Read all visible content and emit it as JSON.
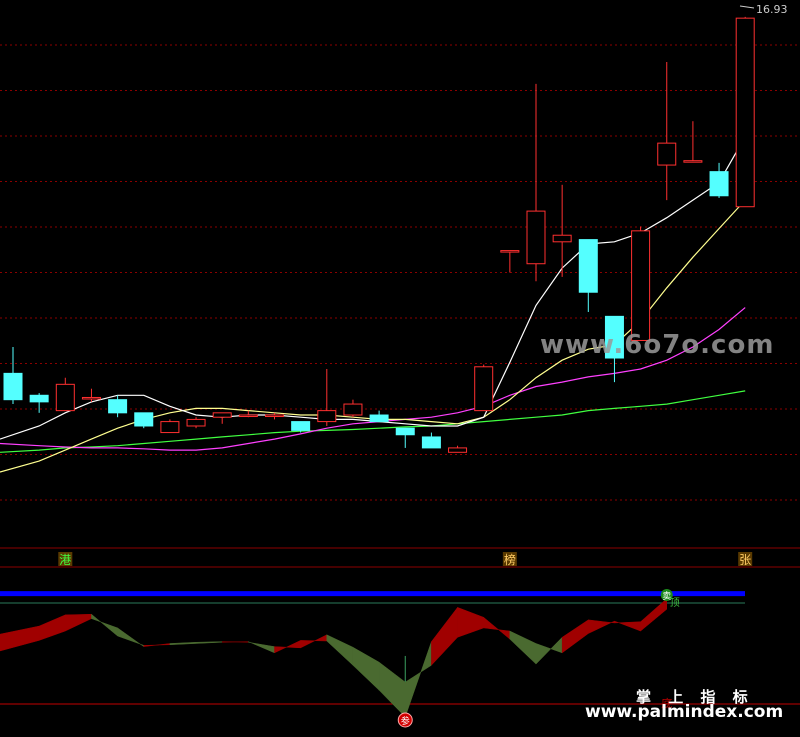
{
  "chart_data": {
    "type": "candlestick",
    "price_label": "16.93",
    "price_axis": {
      "ylim": [
        5.0,
        17.2
      ]
    },
    "candles": [
      {
        "o": 8.8,
        "h": 9.4,
        "l": 8.1,
        "c": 8.2
      },
      {
        "o": 8.3,
        "h": 8.35,
        "l": 7.9,
        "c": 8.15
      },
      {
        "o": 7.95,
        "h": 8.7,
        "l": 7.95,
        "c": 8.55
      },
      {
        "o": 8.25,
        "h": 8.45,
        "l": 8.15,
        "c": 8.25
      },
      {
        "o": 8.2,
        "h": 8.3,
        "l": 7.8,
        "c": 7.9
      },
      {
        "o": 7.9,
        "h": 7.9,
        "l": 7.55,
        "c": 7.6
      },
      {
        "o": 7.45,
        "h": 7.75,
        "l": 7.45,
        "c": 7.7
      },
      {
        "o": 7.6,
        "h": 7.8,
        "l": 7.55,
        "c": 7.75
      },
      {
        "o": 7.8,
        "h": 7.9,
        "l": 7.65,
        "c": 7.9
      },
      {
        "o": 7.85,
        "h": 7.95,
        "l": 7.8,
        "c": 7.85
      },
      {
        "o": 7.85,
        "h": 7.9,
        "l": 7.75,
        "c": 7.85
      },
      {
        "o": 7.7,
        "h": 7.7,
        "l": 7.45,
        "c": 7.5
      },
      {
        "o": 7.7,
        "h": 8.9,
        "l": 7.6,
        "c": 7.95
      },
      {
        "o": 7.85,
        "h": 8.2,
        "l": 7.8,
        "c": 8.1
      },
      {
        "o": 7.85,
        "h": 7.95,
        "l": 7.7,
        "c": 7.7
      },
      {
        "o": 7.55,
        "h": 7.55,
        "l": 7.1,
        "c": 7.4
      },
      {
        "o": 7.35,
        "h": 7.45,
        "l": 7.3,
        "c": 7.1
      },
      {
        "o": 7.0,
        "h": 7.15,
        "l": 7.0,
        "c": 7.1
      },
      {
        "o": 7.95,
        "h": 9.0,
        "l": 7.95,
        "c": 8.95
      },
      {
        "o": 11.6,
        "h": 11.6,
        "l": 11.1,
        "c": 11.6
      },
      {
        "o": 11.3,
        "h": 15.4,
        "l": 10.9,
        "c": 12.5
      },
      {
        "o": 11.8,
        "h": 13.1,
        "l": 11.0,
        "c": 11.95
      },
      {
        "o": 11.85,
        "h": 11.85,
        "l": 10.2,
        "c": 10.65
      },
      {
        "o": 10.1,
        "h": 10.1,
        "l": 8.6,
        "c": 9.15
      },
      {
        "o": 9.55,
        "h": 12.15,
        "l": 9.55,
        "c": 12.05
      },
      {
        "o": 13.55,
        "h": 15.9,
        "l": 12.75,
        "c": 14.05
      },
      {
        "o": 13.65,
        "h": 14.55,
        "l": 13.65,
        "c": 13.65
      },
      {
        "o": 13.4,
        "h": 13.6,
        "l": 12.8,
        "c": 12.85
      },
      {
        "o": 12.6,
        "h": 16.93,
        "l": 12.6,
        "c": 16.9
      }
    ],
    "ma_white": [
      7.3,
      7.6,
      7.9,
      8.15,
      8.3,
      8.3,
      8.05,
      7.85,
      7.8,
      7.85,
      7.85,
      7.8,
      7.75,
      7.75,
      7.7,
      7.65,
      7.6,
      7.6,
      7.8,
      9.05,
      10.35,
      11.2,
      11.75,
      11.8,
      12.0,
      12.35,
      12.75,
      13.15,
      14.2
    ],
    "ma_yellow": [
      6.55,
      6.8,
      7.05,
      7.3,
      7.55,
      7.75,
      7.9,
      8.0,
      8.0,
      7.95,
      7.9,
      7.85,
      7.85,
      7.8,
      7.75,
      7.75,
      7.7,
      7.65,
      7.8,
      8.2,
      8.7,
      9.1,
      9.35,
      9.45,
      10.0,
      10.75,
      11.45,
      12.1,
      12.75
    ],
    "ma_magenta": [
      7.2,
      7.15,
      7.12,
      7.1,
      7.1,
      7.08,
      7.05,
      7.05,
      7.1,
      7.2,
      7.3,
      7.42,
      7.55,
      7.65,
      7.7,
      7.75,
      7.8,
      7.9,
      8.05,
      8.3,
      8.5,
      8.6,
      8.72,
      8.8,
      8.9,
      9.1,
      9.4,
      9.8,
      10.3
    ],
    "ma_green": [
      7.0,
      7.05,
      7.1,
      7.12,
      7.15,
      7.2,
      7.25,
      7.3,
      7.35,
      7.4,
      7.45,
      7.48,
      7.5,
      7.52,
      7.55,
      7.58,
      7.6,
      7.65,
      7.7,
      7.75,
      7.8,
      7.85,
      7.95,
      8.0,
      8.05,
      8.1,
      8.2,
      8.3,
      8.4
    ],
    "signal_labels": [
      {
        "index": 2,
        "text": "港"
      },
      {
        "index": 19,
        "text": "榜"
      },
      {
        "index": 28,
        "text": "张"
      }
    ],
    "indicator": {
      "ylim": [
        -10,
        12
      ],
      "upper_line": 9.0,
      "upper_line_color": "#0000ff",
      "line_a": [
        2.5,
        3.8,
        5.6,
        5.7,
        2.2,
        0.7,
        0.8,
        1.0,
        1.2,
        1.3,
        -0.5,
        1.5,
        1.4,
        -2.5,
        -6.5,
        -10.8,
        1.3,
        6.8,
        5.2,
        1.7,
        -2.3,
        2.0,
        4.8,
        4.3,
        4.5,
        8.2
      ],
      "line_b": [
        -0.2,
        1.5,
        3.0,
        5.0,
        3.5,
        0.5,
        1.0,
        1.2,
        1.3,
        1.2,
        0.5,
        0.3,
        2.4,
        0.4,
        -2.0,
        -5.2,
        -2.5,
        2.0,
        3.5,
        3.0,
        1.0,
        -0.5,
        2.6,
        4.6,
        3.0,
        6.5
      ],
      "bars": [
        2.4,
        3.2,
        3.5,
        3.8,
        2.8,
        2.0,
        1.8,
        1.8,
        1.9,
        2.0,
        1.7,
        1.5,
        1.6,
        0.5,
        0.0,
        -1.0,
        0.2,
        2.0,
        3.6,
        4.0,
        4.2,
        4.5,
        4.8,
        4.8,
        4.8,
        6.8
      ],
      "labels": [
        {
          "text": "卖",
          "color": "#2a8a2a"
        },
        {
          "text": "顶",
          "color": "#2a8a2a"
        },
        {
          "text": "底",
          "color": "#c00000"
        },
        {
          "text": "参",
          "color": "#d00000"
        }
      ]
    }
  },
  "watermarks": [
    "www.6o7o.com",
    "掌 上 指 标",
    "www.palmindex.com"
  ],
  "colors": {
    "background": "#000000",
    "up": "#ff3030",
    "down": "#54ffff",
    "grid": "#8b0000",
    "ma_white": "#ffffff",
    "ma_yellow": "#ffff90",
    "ma_magenta": "#ff40ff",
    "ma_green": "#40ff40",
    "fill_up": "#a00000",
    "fill_down": "#4a6a30"
  }
}
